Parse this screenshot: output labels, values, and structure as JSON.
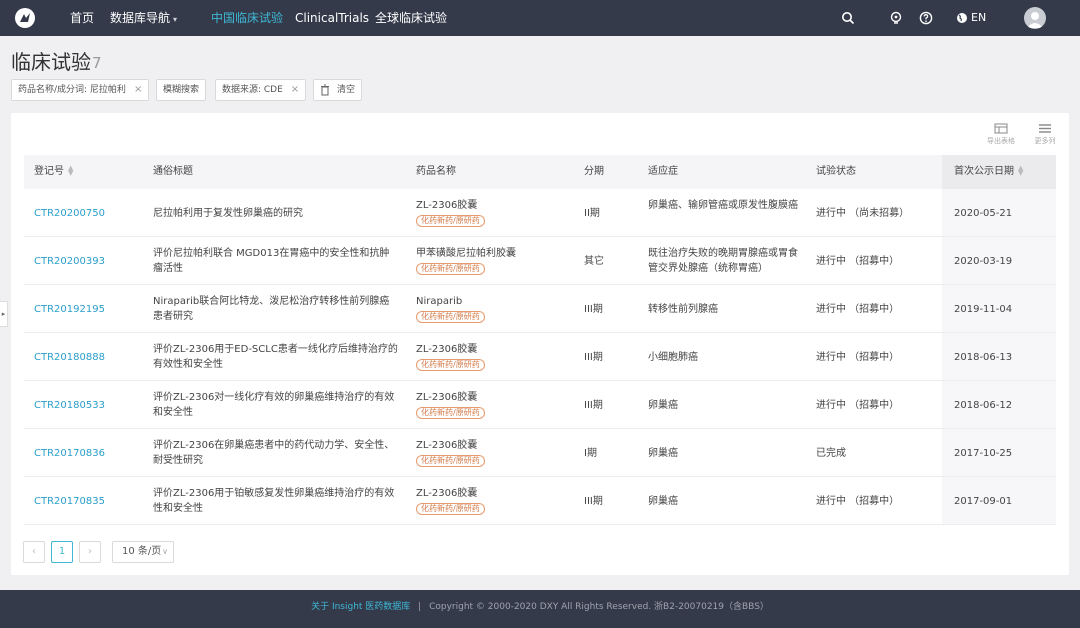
{
  "nav": {
    "items": [
      "首页",
      "数据库导航",
      "中国临床试验",
      "ClinicalTrials",
      "全球临床试验"
    ],
    "active_index": 2,
    "lang": "EN",
    "icons": [
      "search-icon",
      "lightbulb-icon",
      "help-icon",
      "globe-icon",
      "user-avatar"
    ]
  },
  "header": {
    "title": "临床试验",
    "count": "7"
  },
  "filters": {
    "drug": "药品名称/成分词: 尼拉帕利",
    "fuzzy": "模糊搜索",
    "source": "数据来源: CDE",
    "clear": "清空"
  },
  "toolbar": {
    "export": "导出表格",
    "more": "更多列"
  },
  "table": {
    "headers": [
      "登记号",
      "通俗标题",
      "药品名称",
      "分期",
      "适应症",
      "试验状态",
      "首次公示日期"
    ],
    "rows": [
      {
        "id": "CTR20200750",
        "title": "尼拉帕利用于复发性卵巢癌的研究",
        "drug": "ZL-2306胶囊",
        "tag": "化药新药/原研药",
        "phase": "II期",
        "ind": "卵巢癌、输卵管癌或原发性腹膜癌",
        "status": "进行中 （尚未招募）",
        "date": "2020-05-21"
      },
      {
        "id": "CTR20200393",
        "title": "评价尼拉帕利联合 MGD013在胃癌中的安全性和抗肿瘤活性",
        "drug": "甲苯磺酸尼拉帕利胶囊",
        "tag": "化药新药/原研药",
        "phase": "其它",
        "ind": "既往治疗失败的晚期胃腺癌或胃食管交界处腺癌（统称胃癌）",
        "status": "进行中 （招募中）",
        "date": "2020-03-19"
      },
      {
        "id": "CTR20192195",
        "title": "Niraparib联合阿比特龙、泼尼松治疗转移性前列腺癌患者研究",
        "drug": "Niraparib",
        "tag": "化药新药/原研药",
        "phase": "III期",
        "ind": "转移性前列腺癌",
        "status": "进行中 （招募中）",
        "date": "2019-11-04"
      },
      {
        "id": "CTR20180888",
        "title": "评价ZL-2306用于ED-SCLC患者一线化疗后维持治疗的有效性和安全性",
        "drug": "ZL-2306胶囊",
        "tag": "化药新药/原研药",
        "phase": "III期",
        "ind": "小细胞肺癌",
        "status": "进行中 （招募中）",
        "date": "2018-06-13"
      },
      {
        "id": "CTR20180533",
        "title": "评价ZL-2306对一线化疗有效的卵巢癌维持治疗的有效和安全性",
        "drug": "ZL-2306胶囊",
        "tag": "化药新药/原研药",
        "phase": "III期",
        "ind": "卵巢癌",
        "status": "进行中 （招募中）",
        "date": "2018-06-12"
      },
      {
        "id": "CTR20170836",
        "title": "评价ZL-2306在卵巢癌患者中的药代动力学、安全性、耐受性研究",
        "drug": "ZL-2306胶囊",
        "tag": "化药新药/原研药",
        "phase": "I期",
        "ind": "卵巢癌",
        "status": "已完成",
        "date": "2017-10-25"
      },
      {
        "id": "CTR20170835",
        "title": "评价ZL-2306用于铂敏感复发性卵巢癌维持治疗的有效性和安全性",
        "drug": "ZL-2306胶囊",
        "tag": "化药新药/原研药",
        "phase": "III期",
        "ind": "卵巢癌",
        "status": "进行中 （招募中）",
        "date": "2017-09-01"
      }
    ]
  },
  "pagination": {
    "current": "1",
    "page_size": "10 条/页",
    "prev": "‹",
    "next": "›"
  },
  "footer": {
    "link": "关于 Insight 医药数据库",
    "sep": "|",
    "copyright": "Copyright © 2000-2020 DXY All Rights Reserved. 浙B2-20070219（含BBS）"
  }
}
